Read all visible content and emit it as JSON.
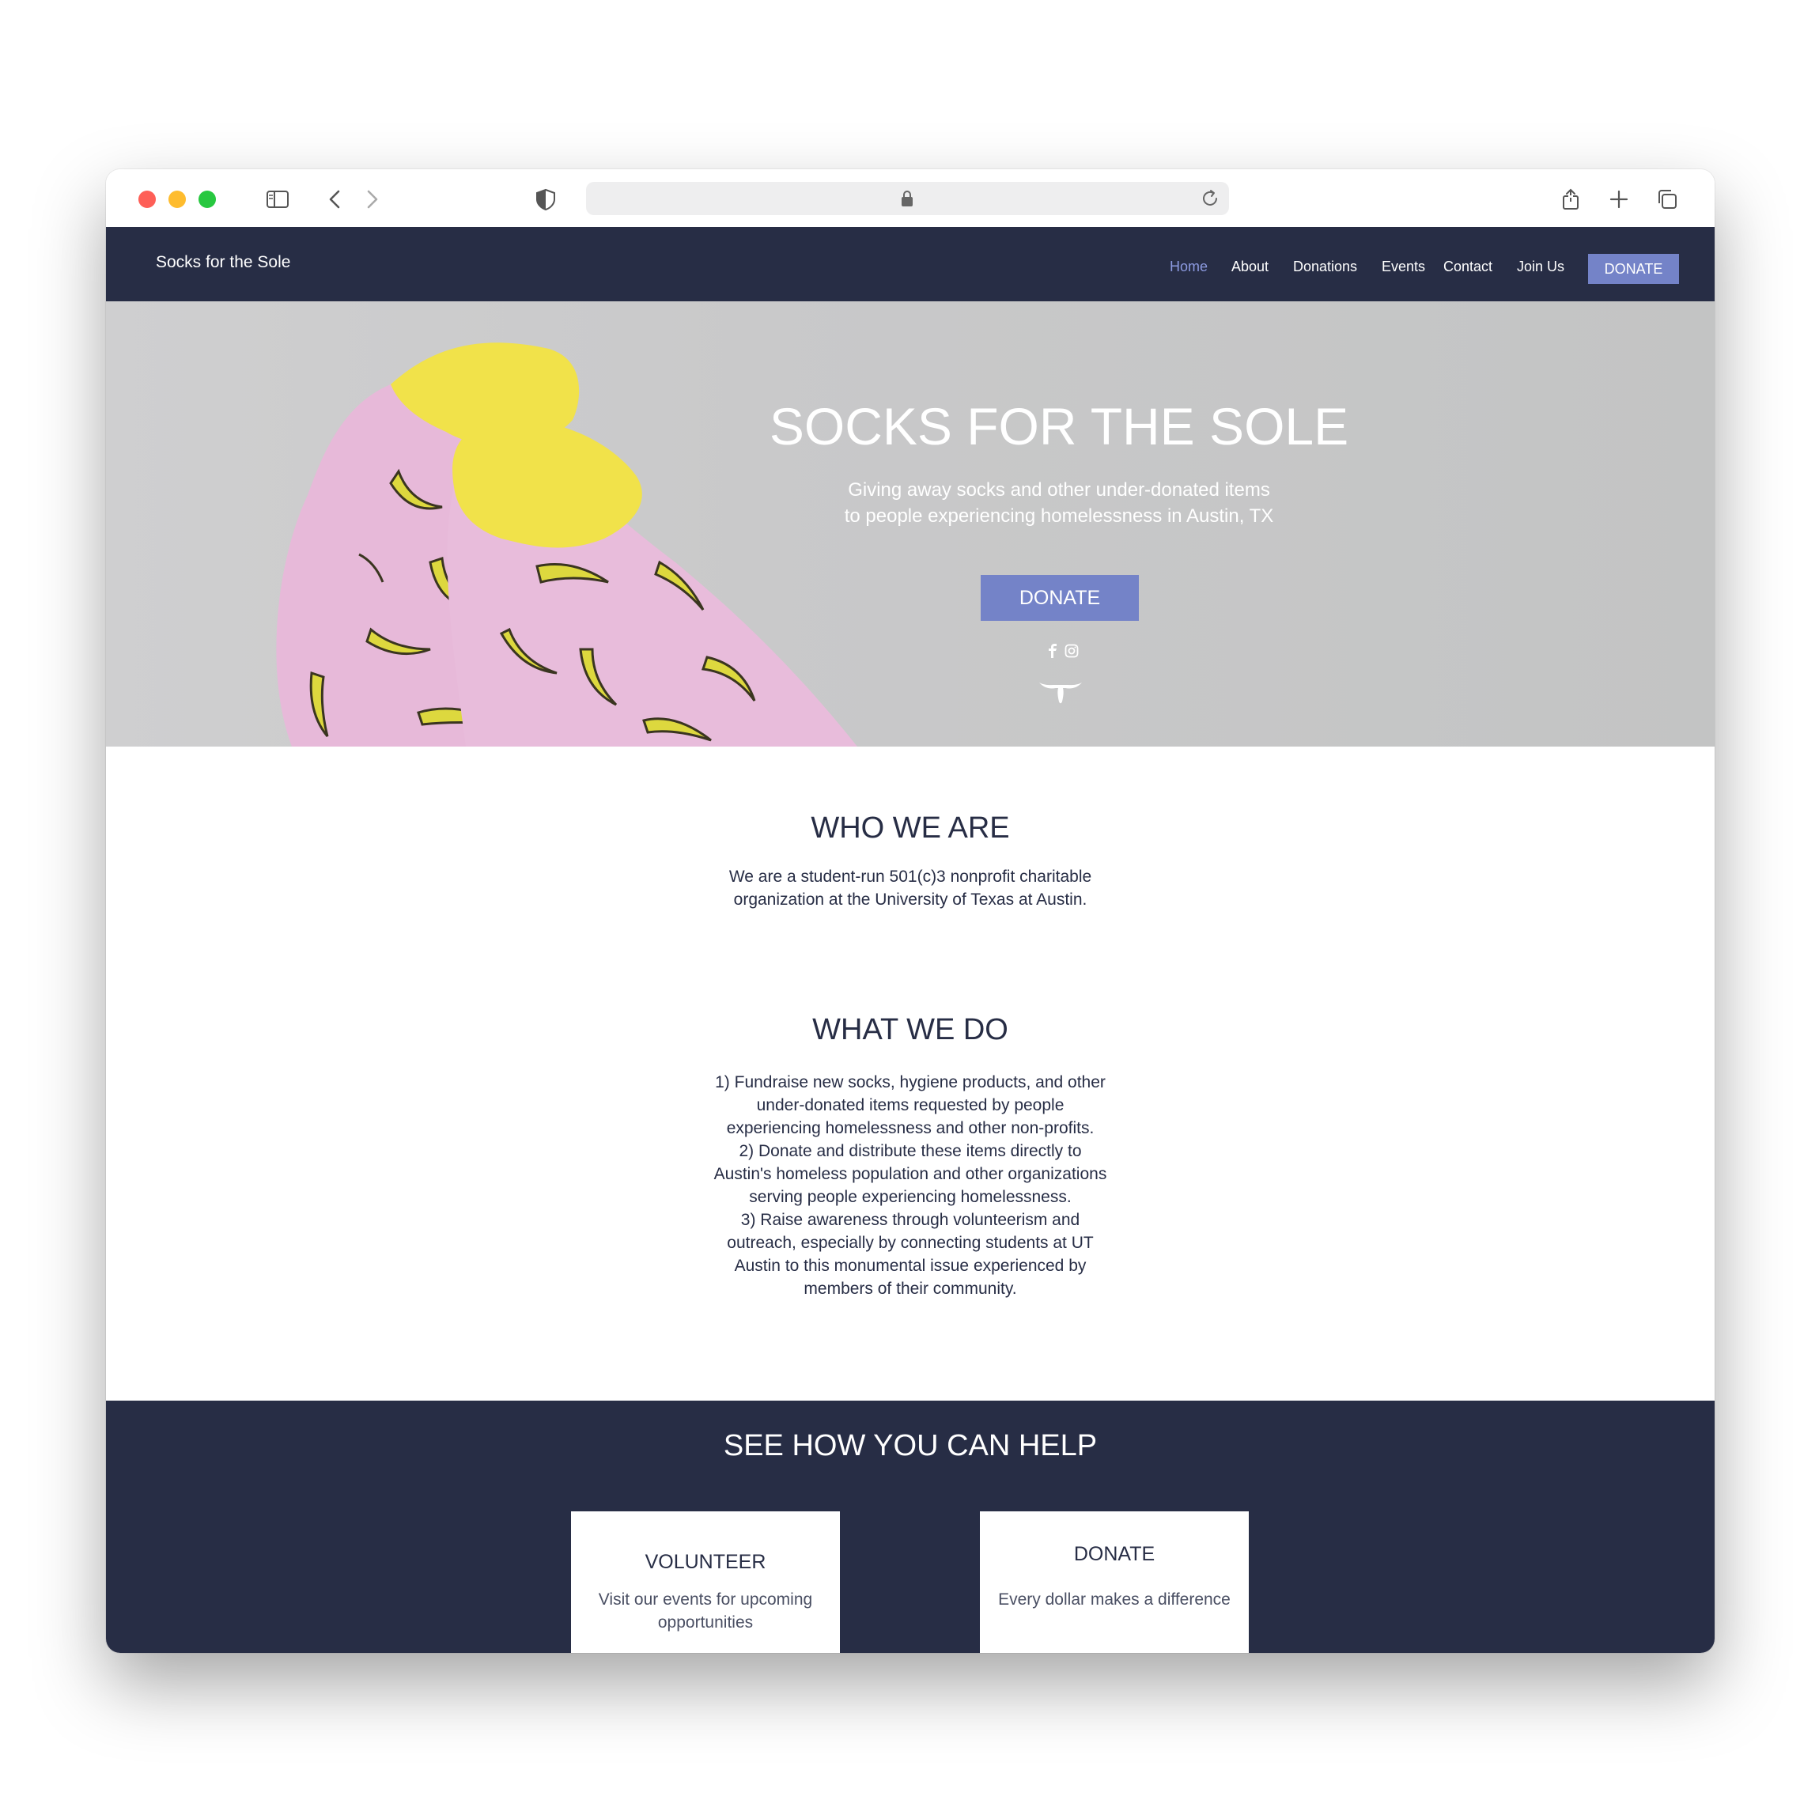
{
  "brand": "Socks for the Sole",
  "nav": {
    "items": [
      {
        "label": "Home",
        "active": true
      },
      {
        "label": "About"
      },
      {
        "label": "Donations"
      },
      {
        "label": "Events"
      },
      {
        "label": "Contact"
      },
      {
        "label": "Join Us"
      }
    ],
    "donate_label": "DONATE"
  },
  "hero": {
    "title": "SOCKS FOR THE SOLE",
    "subtitle_line1": "Giving away socks and other under-donated items",
    "subtitle_line2": "to people experiencing homelessness in Austin, TX",
    "donate_label": "DONATE",
    "social_icons": [
      "facebook-icon",
      "instagram-icon"
    ],
    "logo_icon": "longhorn-icon"
  },
  "who": {
    "title": "WHO WE ARE",
    "body": "We are a student-run 501(c)3 nonprofit charitable organization at the University of Texas at Austin."
  },
  "what": {
    "title": "WHAT WE DO",
    "items": [
      "1) Fundraise new socks, hygiene products, and other under-donated items requested by people experiencing homelessness and other non-profits.",
      "2) Donate and distribute these items directly to Austin's homeless population and other organizations serving people experiencing homelessness.",
      "3) Raise awareness through volunteerism and outreach, especially by connecting students at UT Austin to this monumental issue experienced by members of their community."
    ]
  },
  "help": {
    "title": "SEE HOW YOU CAN HELP",
    "cards": [
      {
        "title": "VOLUNTEER",
        "body": "Visit our events for upcoming opportunities"
      },
      {
        "title": "DONATE",
        "body": "Every dollar makes a difference"
      }
    ]
  },
  "colors": {
    "navy": "#272d45",
    "accent": "#7483c8",
    "nav_active": "#8c9ae0"
  }
}
